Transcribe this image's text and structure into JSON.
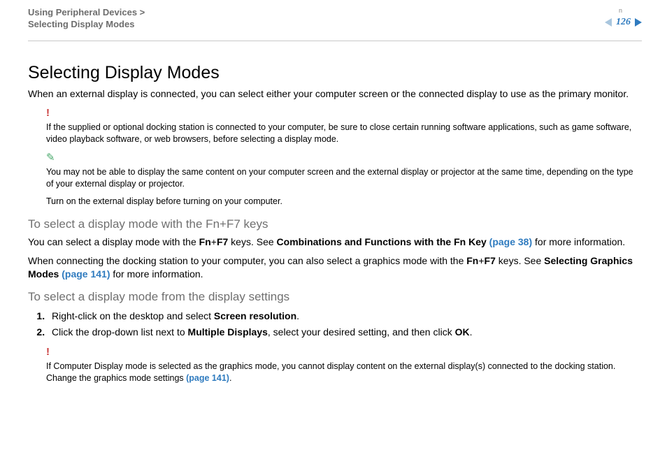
{
  "header": {
    "breadcrumb_parent": "Using Peripheral Devices >",
    "breadcrumb_current": "Selecting Display Modes",
    "page_number": "126",
    "n_mark": "n"
  },
  "content": {
    "title": "Selecting Display Modes",
    "intro": "When an external display is connected, you can select either your computer screen or the connected display to use as the primary monitor.",
    "warn1_icon": "!",
    "warn1_text": "If the supplied or optional docking station is connected to your computer, be sure to close certain running software applications, such as game software, video playback software, or web browsers, before selecting a display mode.",
    "tip_icon": "✎",
    "tip_text": "You may not be able to display the same content on your computer screen and the external display or projector at the same time, depending on the type of your external display or projector.",
    "tip_text2": "Turn on the external display before turning on your computer.",
    "h2_a": "To select a display mode with the Fn+F7 keys",
    "para_a_pre": "You can select a display mode with the ",
    "para_a_fn": "Fn",
    "para_a_plus1": "+",
    "para_a_f7": "F7",
    "para_a_mid": " keys. See ",
    "para_a_bold": "Combinations and Functions with the Fn Key ",
    "para_a_link": "(page 38)",
    "para_a_post": " for more information.",
    "para_b_pre": "When connecting the docking station to your computer, you can also select a graphics mode with the ",
    "para_b_fn": "Fn",
    "para_b_plus": "+",
    "para_b_f7": "F7",
    "para_b_mid": " keys. See ",
    "para_b_bold": "Selecting Graphics Modes ",
    "para_b_link": "(page 141)",
    "para_b_post": " for more information.",
    "h2_b": "To select a display mode from the display settings",
    "step1_pre": "Right-click on the desktop and select ",
    "step1_bold": "Screen resolution",
    "step1_post": ".",
    "step2_pre": "Click the drop-down list next to ",
    "step2_bold1": "Multiple Displays",
    "step2_mid": ", select your desired setting, and then click ",
    "step2_bold2": "OK",
    "step2_post": ".",
    "warn2_icon": "!",
    "warn2_text_pre": "If Computer Display mode is selected as the graphics mode, you cannot display content on the external display(s) connected to the docking station. Change the graphics mode settings ",
    "warn2_link": "(page 141)",
    "warn2_text_post": "."
  }
}
